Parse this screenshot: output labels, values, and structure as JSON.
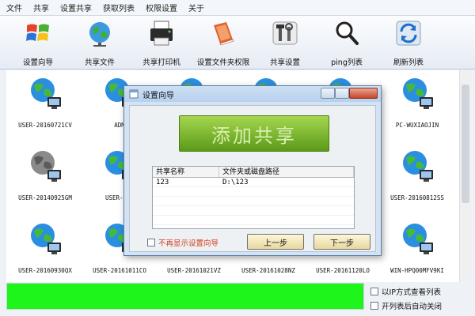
{
  "menu": [
    "文件",
    "共享",
    "设置共享",
    "获取列表",
    "权限设置",
    "关于"
  ],
  "toolbar": [
    {
      "label": "设置向导",
      "icon": "windows-flag-icon"
    },
    {
      "label": "共享文件",
      "icon": "globe-network-icon"
    },
    {
      "label": "共享打印机",
      "icon": "printer-icon"
    },
    {
      "label": "设置文件夹权限",
      "icon": "folder-book-icon"
    },
    {
      "label": "共享设置",
      "icon": "tools-icon"
    },
    {
      "label": "ping列表",
      "icon": "magnifier-icon"
    },
    {
      "label": "刷新列表",
      "icon": "refresh-icon"
    }
  ],
  "hosts": [
    {
      "name": "USER-20160721CV",
      "style": "color"
    },
    {
      "name": "ADM",
      "style": "color"
    },
    {
      "name": "",
      "style": "color"
    },
    {
      "name": "",
      "style": "color"
    },
    {
      "name": "",
      "style": "color"
    },
    {
      "name": "PC-WUXIAOJIN",
      "style": "color"
    },
    {
      "name": "USER-20140925GM",
      "style": "gray"
    },
    {
      "name": "USER-201",
      "style": "color"
    },
    {
      "name": "USER-20160812SS",
      "style": "color"
    },
    {
      "name": "USER-20160930QX",
      "style": "color"
    },
    {
      "name": "USER-20161011CO",
      "style": "color"
    },
    {
      "name": "USER-20161021VZ",
      "style": "color"
    },
    {
      "name": "USER-20161028NZ",
      "style": "color"
    },
    {
      "name": "USER-20161120LO",
      "style": "color"
    },
    {
      "name": "WIN-HPQ00MFV9KI",
      "style": "color"
    }
  ],
  "progress_fraction": 1.0,
  "options": {
    "ip_view": "以IP方式查看列表",
    "close_after": "开列表后自动关闭"
  },
  "dialog": {
    "title": "设置向导",
    "add_share": "添加共享",
    "table": {
      "headers": [
        "共享名称",
        "文件夹或磁盘路径"
      ],
      "rows": [
        [
          "123",
          "D:\\123"
        ]
      ]
    },
    "noshow": "不再显示设置向导",
    "prev": "上一步",
    "next": "下一步"
  },
  "colors": {
    "progress": "#1ef51a",
    "add_share_button": "#7bb82c",
    "noshow_text": "#d23a1a"
  }
}
